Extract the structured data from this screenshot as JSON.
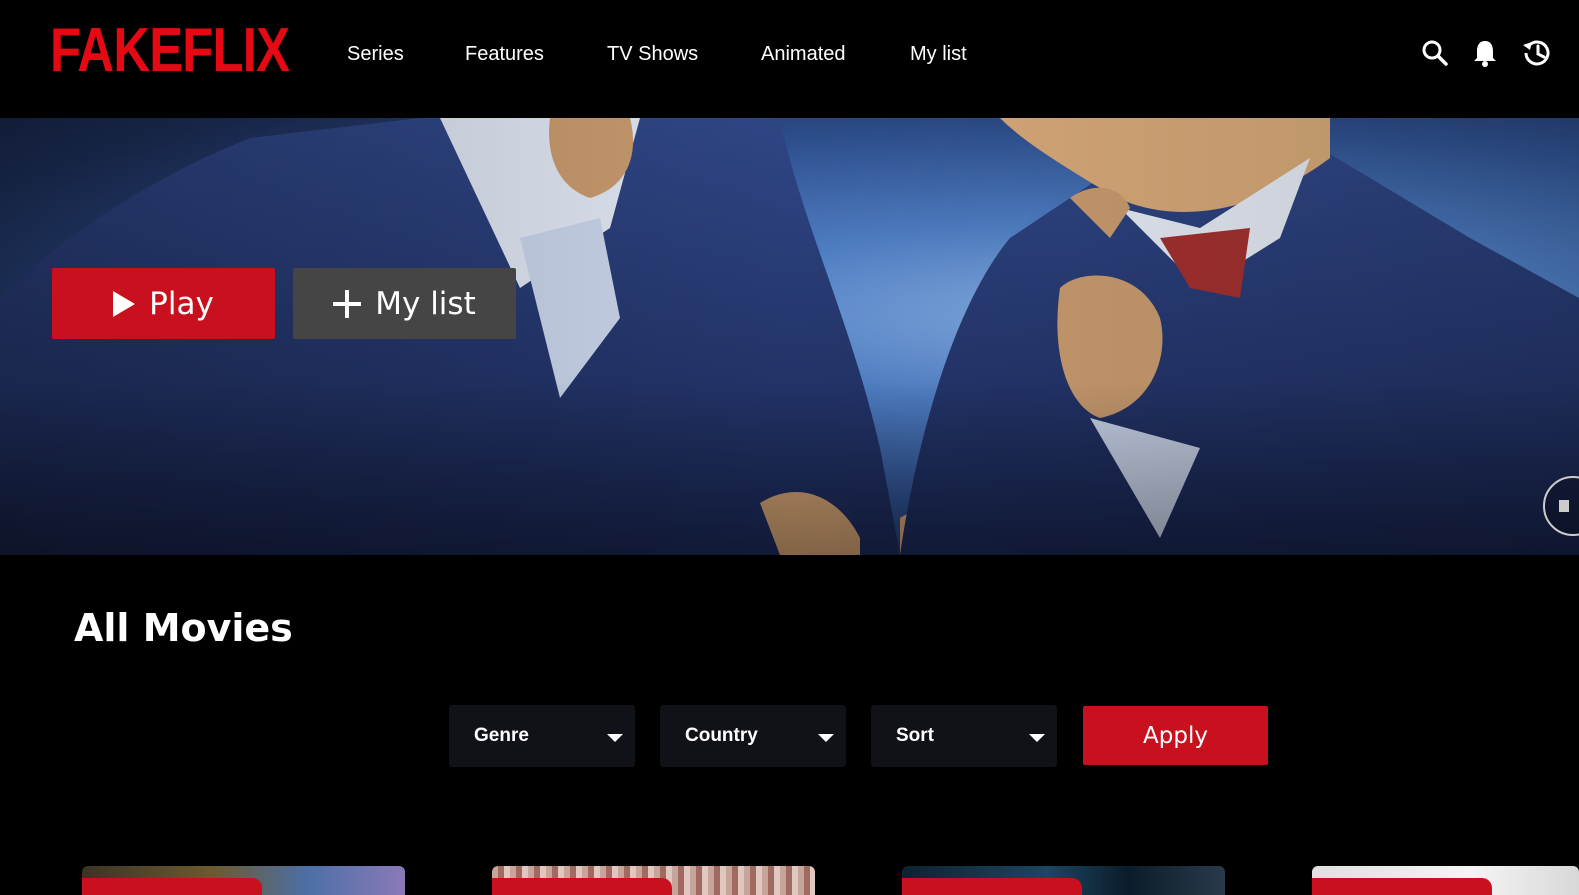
{
  "brand": {
    "logo_text": "FAKEFLIX",
    "accent": "#e50914"
  },
  "nav": {
    "items": [
      {
        "label": "Series"
      },
      {
        "label": "Features"
      },
      {
        "label": "TV Shows"
      },
      {
        "label": "Animated"
      },
      {
        "label": "My list"
      }
    ]
  },
  "header_icons": [
    "search-icon",
    "bell-icon",
    "history-icon"
  ],
  "hero": {
    "play_label": "Play",
    "mylist_label": "My list"
  },
  "section": {
    "title": "All Movies",
    "filters": [
      {
        "label": "Genre"
      },
      {
        "label": "Country"
      },
      {
        "label": "Sort"
      }
    ],
    "apply_label": "Apply"
  },
  "colors": {
    "button_red": "#c8101e",
    "button_gray": "#454545",
    "select_bg": "#111218"
  }
}
